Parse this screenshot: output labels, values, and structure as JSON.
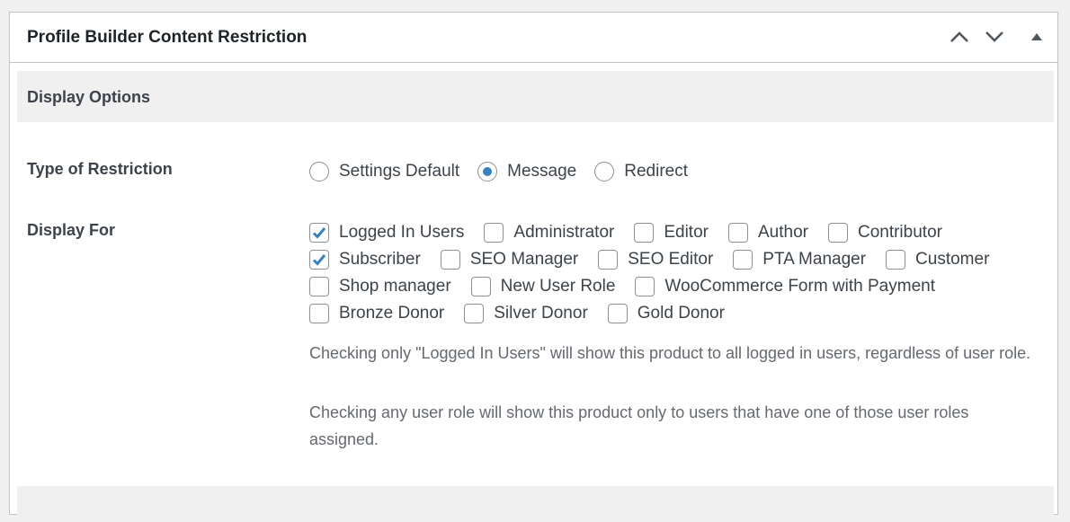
{
  "panel": {
    "title": "Profile Builder Content Restriction",
    "controls": [
      {
        "name": "move-up",
        "icon": "chevron-up-icon"
      },
      {
        "name": "move-down",
        "icon": "chevron-down-icon"
      },
      {
        "name": "toggle-panel",
        "icon": "triangle-up-icon"
      }
    ]
  },
  "section": {
    "title": "Display Options"
  },
  "restriction": {
    "label": "Type of Restriction",
    "options": [
      {
        "label": "Settings Default",
        "selected": false
      },
      {
        "label": "Message",
        "selected": true
      },
      {
        "label": "Redirect",
        "selected": false
      }
    ]
  },
  "display_for": {
    "label": "Display For",
    "rows": [
      [
        {
          "label": "Logged In Users",
          "checked": true
        },
        {
          "label": "Administrator",
          "checked": false
        },
        {
          "label": "Editor",
          "checked": false
        },
        {
          "label": "Author",
          "checked": false
        },
        {
          "label": "Contributor",
          "checked": false
        }
      ],
      [
        {
          "label": "Subscriber",
          "checked": true
        },
        {
          "label": "SEO Manager",
          "checked": false
        },
        {
          "label": "SEO Editor",
          "checked": false
        },
        {
          "label": "PTA Manager",
          "checked": false
        },
        {
          "label": "Customer",
          "checked": false
        }
      ],
      [
        {
          "label": "Shop manager",
          "checked": false
        },
        {
          "label": "New User Role",
          "checked": false
        },
        {
          "label": "WooCommerce Form with Payment",
          "checked": false
        }
      ],
      [
        {
          "label": "Bronze Donor",
          "checked": false
        },
        {
          "label": "Silver Donor",
          "checked": false
        },
        {
          "label": "Gold Donor",
          "checked": false
        }
      ]
    ],
    "help": [
      "Checking only \"Logged In Users\" will show this product to all logged in users, regardless of user role.",
      "Checking any user role will show this product only to users that have one of those user roles assigned."
    ]
  },
  "colors": {
    "accent": "#3582c4",
    "border": "#c3c4c7",
    "section_bg": "#f0f0f1"
  }
}
